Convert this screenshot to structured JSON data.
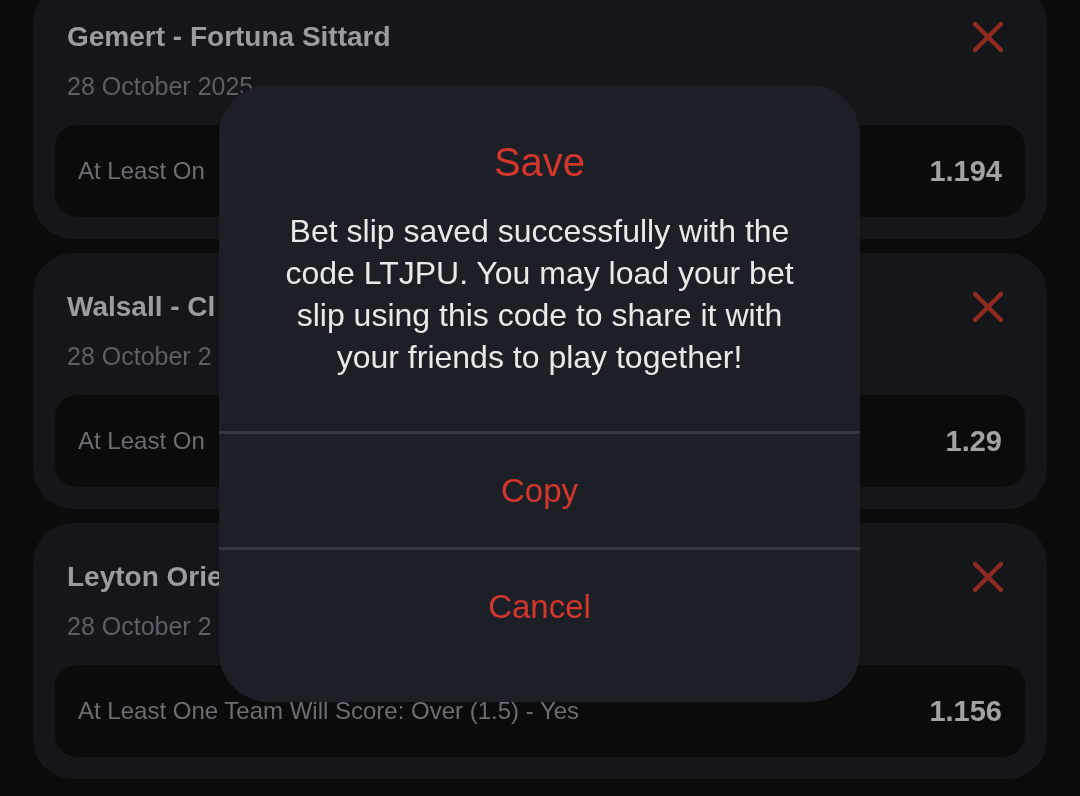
{
  "bets": [
    {
      "title": "Gemert - Fortuna Sittard",
      "date": "28 October 2025",
      "selection": "At Least On",
      "odds": "1.194"
    },
    {
      "title": "Walsall - Cl",
      "date": "28 October 2",
      "selection": "At Least On",
      "odds": "1.29"
    },
    {
      "title": "Leyton Orie",
      "date": "28 October 2",
      "selection": "At Least One Team Will Score: Over (1.5) - Yes",
      "odds": "1.156"
    }
  ],
  "dialog": {
    "title": "Save",
    "message": "Bet slip saved successfully with the code LTJPU. You may load your bet slip using this code to share it with your friends to play together!",
    "buttons": [
      "Copy",
      "Cancel"
    ]
  }
}
